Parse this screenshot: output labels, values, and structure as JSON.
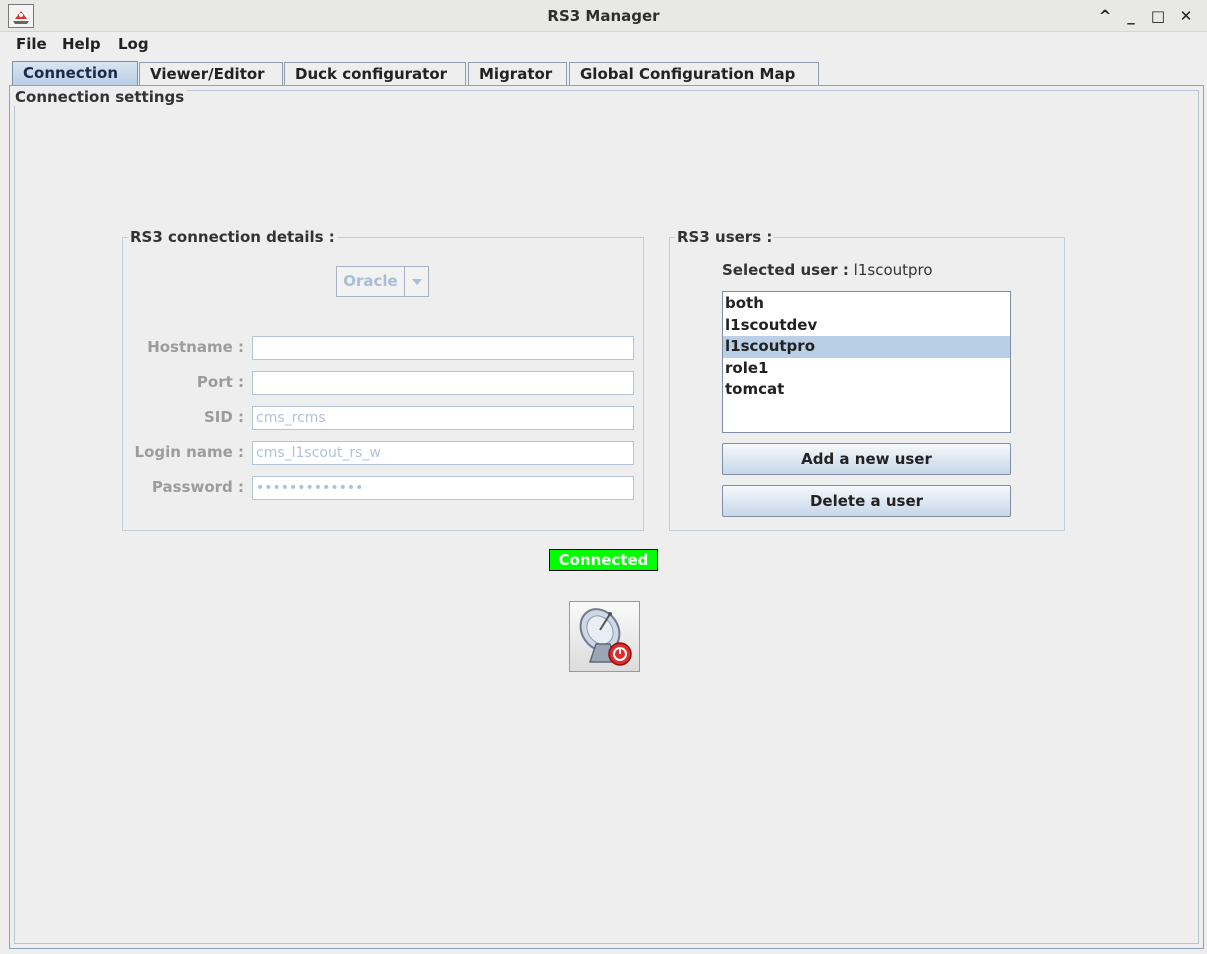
{
  "window": {
    "title": "RS3 Manager",
    "controls": {
      "minimize_up": "^",
      "minimize": "_",
      "maximize": "□",
      "close": "✕"
    }
  },
  "menu": [
    "File",
    "Help",
    "Log"
  ],
  "tabs": [
    "Connection",
    "Viewer/Editor",
    "Duck configurator",
    "Migrator",
    "Global Configuration Map"
  ],
  "active_tab": "Connection",
  "panel_title": "Connection settings",
  "connection_details": {
    "title": "RS3 connection details :",
    "db_type": "Oracle",
    "fields": {
      "hostname": {
        "label": "Hostname :",
        "value": ""
      },
      "port": {
        "label": "Port :",
        "value": ""
      },
      "sid": {
        "label": "SID :",
        "value": "cms_rcms"
      },
      "login": {
        "label": "Login name :",
        "value": "cms_l1scout_rs_w"
      },
      "password": {
        "label": "Password :",
        "value": "•••••••••••••"
      }
    }
  },
  "users": {
    "title": "RS3 users :",
    "selected_label": "Selected user :",
    "selected_value": "l1scoutpro",
    "list": [
      "both",
      "l1scoutdev",
      "l1scoutpro",
      "role1",
      "tomcat"
    ],
    "add_button": "Add a new user",
    "delete_button": "Delete a user"
  },
  "status": {
    "text": "Connected",
    "color": "#00ff00"
  },
  "colors": {
    "accent": "#b8cfe5",
    "disabled_text": "#a8bdd6"
  },
  "connect_button_icon": "satellite-dish-disconnect-icon"
}
